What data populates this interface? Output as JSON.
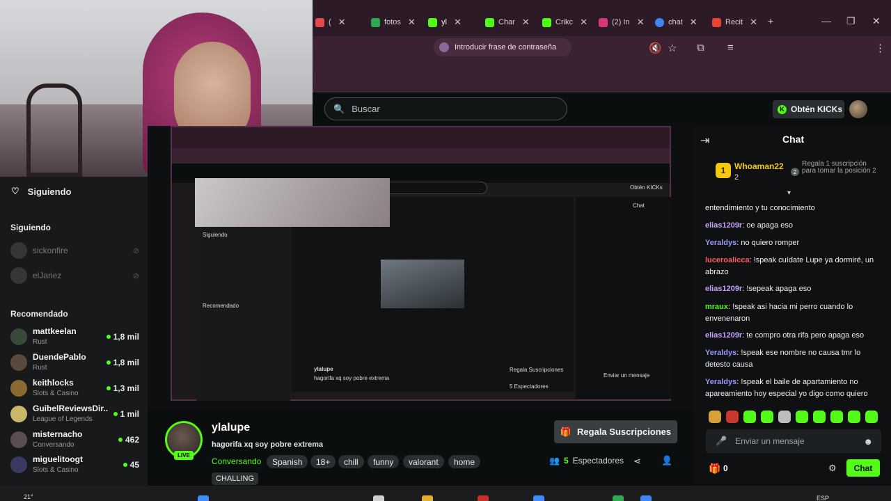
{
  "browser": {
    "tabs": [
      {
        "label": "(",
        "x": 0
      },
      {
        "label": "fotos",
        "x": 0
      },
      {
        "label": "yl",
        "x": 0
      },
      {
        "label": "Char",
        "x": 0
      },
      {
        "label": "Crikc",
        "x": 0
      },
      {
        "label": "(2) In",
        "x": 0
      },
      {
        "label": "chat",
        "x": 0
      },
      {
        "label": "Recit",
        "x": 0
      }
    ],
    "password_prompt": "Introducir frase de contraseña"
  },
  "header": {
    "search_placeholder": "Buscar",
    "get_kicks": "Obtén KICKs"
  },
  "sidebar": {
    "following_title": "Siguiendo",
    "following_section": "Siguiendo",
    "offline": [
      "sickonfire",
      "elJariez"
    ],
    "recommended_section": "Recomendado",
    "items": [
      {
        "name": "mattkeelan",
        "category": "Rust",
        "viewers": "1,8 mil",
        "color": "#3a4a3a"
      },
      {
        "name": "DuendePablo",
        "category": "Rust",
        "viewers": "1,8 mil",
        "color": "#5a4a3e"
      },
      {
        "name": "keithlocks",
        "category": "Slots & Casino",
        "viewers": "1,3 mil",
        "color": "#8a6a30"
      },
      {
        "name": "GuibelReviewsDir...",
        "category": "League of Legends",
        "viewers": "1 mil",
        "color": "#c9b76a"
      },
      {
        "name": "misternacho",
        "category": "Conversando",
        "viewers": "462",
        "color": "#5a4e52"
      },
      {
        "name": "miguelitoogt",
        "category": "Slots & Casino",
        "viewers": "45",
        "color": "#3a3a60"
      }
    ]
  },
  "capture": {
    "inner_search": "Buscar",
    "inner_kicks": "Obtén KICKs",
    "inner_following": "Siguiendo",
    "inner_recommended": "Recomendado",
    "inner_chat": "Chat",
    "inner_name": "ylalupe",
    "inner_title": "hagorifa xq soy pobre extrema",
    "inner_subs": "Regala Suscripciones",
    "inner_viewers": "5 Espectadores",
    "inner_send": "Enviar un mensaje"
  },
  "stream": {
    "live": "LIVE",
    "name": "ylalupe",
    "title": "hagorifa xq soy pobre extrema",
    "category": "Conversando",
    "tags": [
      "Spanish",
      "18+",
      "chill",
      "funny",
      "valorant",
      "home"
    ],
    "extra_tag": "CHALLING",
    "gift_subs": "Regala Suscripciones",
    "viewers_count": "5",
    "viewers_label": "Espectadores"
  },
  "chat": {
    "title": "Chat",
    "pinned": {
      "rank": "1",
      "name": "Whoaman22",
      "count": "2",
      "next_rank": "2",
      "description": "Regala 1 suscripción para tomar la posición 2"
    },
    "messages": [
      {
        "user": "",
        "text": "entendimiento y tu conocimiento",
        "color": "#f0f0f0"
      },
      {
        "user": "elias1209r",
        "text": "oe apaga eso",
        "color": "#c8a2ff"
      },
      {
        "user": "Yeraldys",
        "text": "no quiero romper",
        "color": "#9b9bff"
      },
      {
        "user": "luceroalicca",
        "text": "!speak cuídate Lupe ya dormiré, un abrazo",
        "color": "#ff5a5a"
      },
      {
        "user": "elias1209r",
        "text": "!sepeak apaga eso",
        "color": "#c8a2ff"
      },
      {
        "user": "mraux",
        "text": "!speak asi hacia mi perro cuando lo envenenaron",
        "color": "#53fc18"
      },
      {
        "user": "elias1209r",
        "text": "te compro otra rifa pero apaga eso",
        "color": "#c8a2ff"
      },
      {
        "user": "Yeraldys",
        "text": "!speak ese nombre no causa tmr lo detesto causa",
        "color": "#9b9bff"
      },
      {
        "user": "Yeraldys",
        "text": "!speak el baile de apartamiento no apareamiento hoy especial yo digo como quiero",
        "color": "#9b9bff"
      }
    ],
    "input_placeholder": "Enviar un mensaje",
    "gift_count": "0",
    "send": "Chat"
  },
  "taskbar": {
    "temperature": "21°",
    "language": "ESP"
  }
}
